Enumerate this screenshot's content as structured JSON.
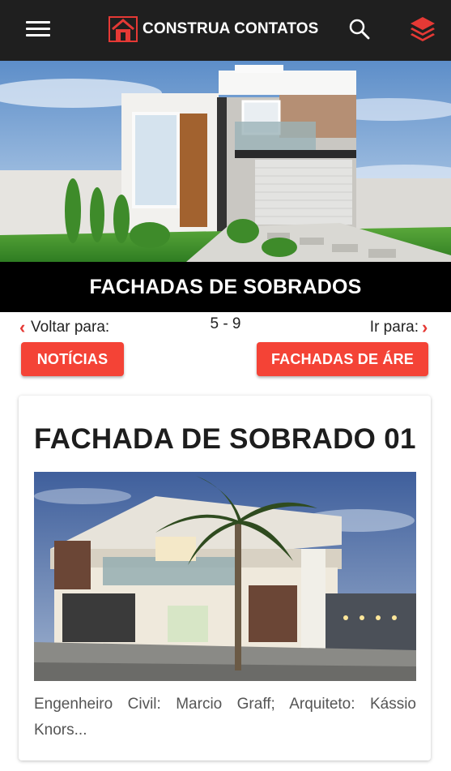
{
  "header": {
    "brand_name": "CONSTRUA CONTATOS",
    "menu_icon": "hamburger-menu-icon",
    "search_icon": "search-icon",
    "layers_icon": "layers-icon",
    "background_color": "#1f1f1f",
    "accent_color": "#e53935"
  },
  "hero": {
    "title": "FACHADAS DE SOBRADOS"
  },
  "pager": {
    "back_label": "Voltar para:",
    "range": "5 - 9",
    "forward_label": "Ir para:",
    "back_button": "NOTÍCIAS",
    "forward_button": "FACHADAS DE ÁRE"
  },
  "card": {
    "title": "FACHADA DE SOBRADO 01",
    "description": "Engenheiro Civil: Marcio Graff; Arquiteto: Kássio Knors..."
  }
}
